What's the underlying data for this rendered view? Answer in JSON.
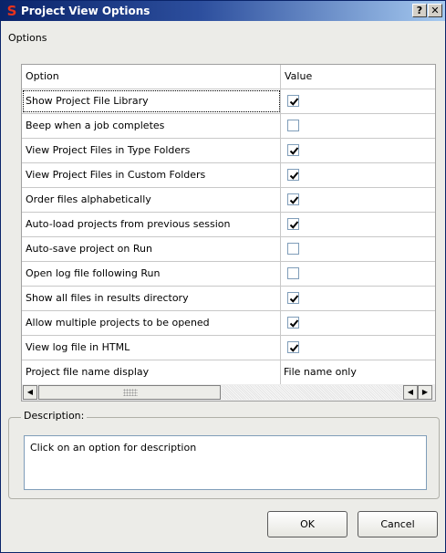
{
  "window": {
    "title": "Project View Options",
    "help_label": "?",
    "close_label": "✕"
  },
  "section_label": "Options",
  "grid": {
    "columns": [
      "Option",
      "Value"
    ],
    "rows": [
      {
        "option": "Show Project File Library",
        "type": "checkbox",
        "checked": true
      },
      {
        "option": "Beep when a job completes",
        "type": "checkbox",
        "checked": false
      },
      {
        "option": "View Project Files in Type Folders",
        "type": "checkbox",
        "checked": true
      },
      {
        "option": "View Project Files in Custom Folders",
        "type": "checkbox",
        "checked": true
      },
      {
        "option": "Order files alphabetically",
        "type": "checkbox",
        "checked": true
      },
      {
        "option": "Auto-load projects from previous session",
        "type": "checkbox",
        "checked": true
      },
      {
        "option": "Auto-save project on Run",
        "type": "checkbox",
        "checked": false
      },
      {
        "option": "Open log file following Run",
        "type": "checkbox",
        "checked": false
      },
      {
        "option": "Show all files in results directory",
        "type": "checkbox",
        "checked": true
      },
      {
        "option": "Allow multiple projects to be opened",
        "type": "checkbox",
        "checked": true
      },
      {
        "option": "View log file in HTML",
        "type": "checkbox",
        "checked": true
      },
      {
        "option": "Project file name display",
        "type": "text",
        "value": "File name only"
      }
    ]
  },
  "description": {
    "legend": "Description:",
    "text": "Click on an option for description"
  },
  "buttons": {
    "ok": "OK",
    "cancel": "Cancel"
  }
}
